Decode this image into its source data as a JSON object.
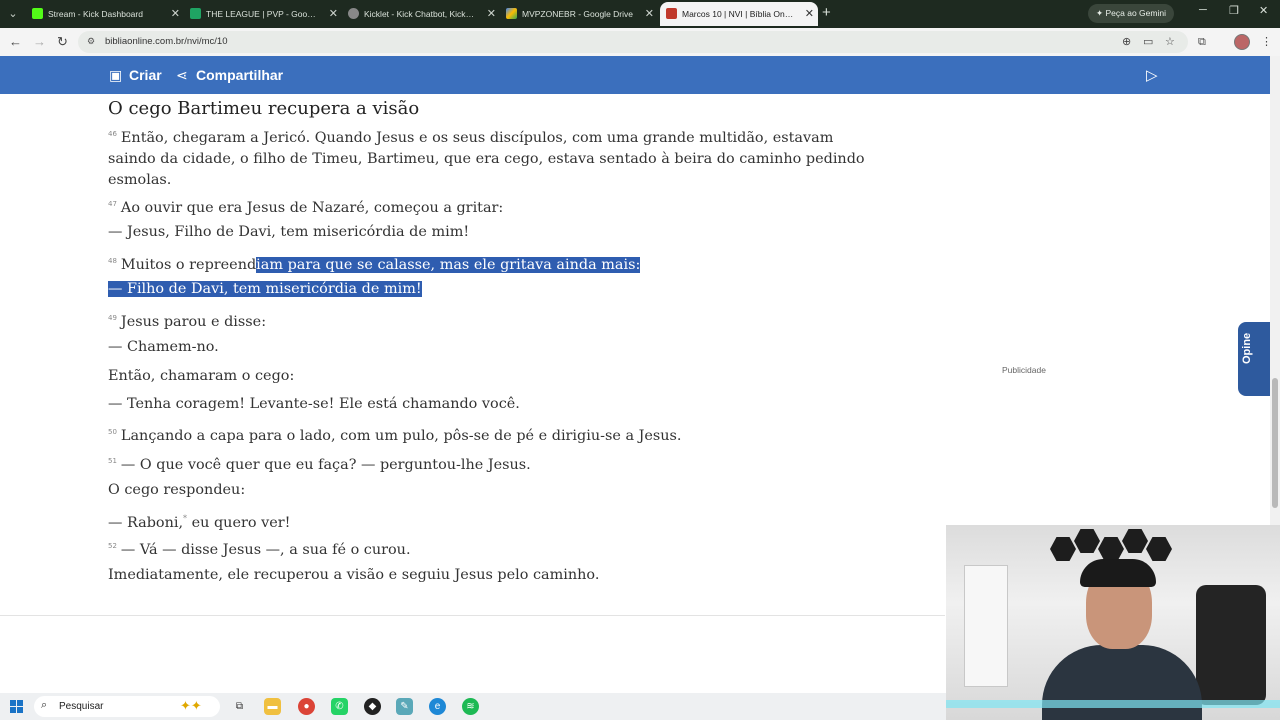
{
  "browser": {
    "tabs": [
      {
        "title": "Stream - Kick Dashboard",
        "color": "#53fc18"
      },
      {
        "title": "THE LEAGUE | PVP - Google Pla",
        "color": "#1fa463"
      },
      {
        "title": "Kicklet - Kick Chatbot, Kick Wid",
        "color": "#888888"
      },
      {
        "title": "MVPZONEBR - Google Drive",
        "color": "#4285f4"
      },
      {
        "title": "Marcos 10 | NVI | Bíblia Online",
        "color": "#c0392b"
      }
    ],
    "gemini_label": "Peça ao Gemini",
    "url": "bibliaonline.com.br/nvi/mc/10"
  },
  "header": {
    "create_label": "Criar",
    "share_label": "Compartilhar"
  },
  "content": {
    "section_title": "O cego Bartimeu recupera a visão",
    "v46_num": "46",
    "v46_text": "Então, chegaram a Jericó. Quando Jesus e os seus discípulos, com uma grande multidão, estavam saindo da cidade, o filho de Timeu, Bartimeu, que era cego, estava sentado à beira do caminho pedindo esmolas.",
    "v47_num": "47",
    "v47_text": "Ao ouvir que era Jesus de Nazaré, começou a gritar:",
    "line_jesus_filho": "— Jesus, Filho de Davi, tem misericórdia de mim!",
    "v48_num": "48",
    "v48_text_a": "Muitos o repreend",
    "v48_text_b": "iam para que se calasse, mas ele gritava ainda mais:",
    "line_filho_davi": "— Filho de Davi, tem misericórdia de mim!",
    "v49_num": "49",
    "v49_text": "Jesus parou e disse:",
    "line_chamem": "— Chamem-no.",
    "line_chamaram": "Então, chamaram o cego:",
    "line_coragem": "— Tenha coragem! Levante-se! Ele está chamando você.",
    "v50_num": "50",
    "v50_text": "Lançando a capa para o lado, com um pulo, pôs-se de pé e dirigiu-se a Jesus.",
    "v51_num": "51",
    "v51_text": "— O que você quer que eu faça? — perguntou-lhe Jesus.",
    "line_respondeu": "O cego respondeu:",
    "line_raboni_a": "— Raboni,",
    "line_raboni_note": "*",
    "line_raboni_b": " eu quero ver!",
    "v52_num": "52",
    "v52_text": "— Vá — disse Jesus —, a sua fé o curou.",
    "line_final": "Imediatamente, ele recuperou a visão e seguiu Jesus pelo caminho."
  },
  "sidebar": {
    "ad_label": "Publicidade",
    "opine_label": "Opine"
  },
  "taskbar": {
    "search_label": "Pesquisar"
  }
}
